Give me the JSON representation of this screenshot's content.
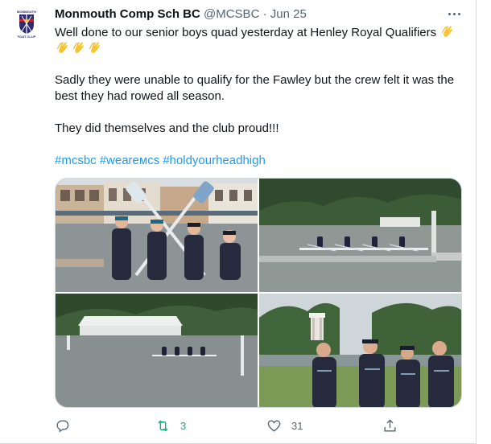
{
  "tweet": {
    "author_name": "Monmouth Comp Sch BC",
    "handle": "@MCSBC",
    "separator": "·",
    "date": "Jun 25",
    "line1": "Well done to our senior boys quad yesterday at Henley Royal Qualifiers",
    "para2_line1": "Sadly they were unable to qualify for the Fawley but the crew felt it was the",
    "para2_line2": "best they had rowed all season.",
    "para3": "They did themselves and the club proud!!!",
    "hashtags": [
      "#mcsbc",
      "#weareмcs",
      "#holdyourheadhigh"
    ],
    "emoji": "clapping-hands",
    "emoji_count": 4
  },
  "avatar": {
    "top_text": "MONMOUTH",
    "bottom_text": "BOAT CLUB"
  },
  "actions": {
    "reply_count": "",
    "retweet_count": "3",
    "like_count": "31",
    "share_count": ""
  },
  "colors": {
    "accent": "#1d9bf0",
    "retweet_green": "#00ba7c",
    "secondary_text": "#536471",
    "border": "#cfd9de",
    "crest_navy": "#2b2d6e",
    "crew_shirt": "#262a3c"
  }
}
